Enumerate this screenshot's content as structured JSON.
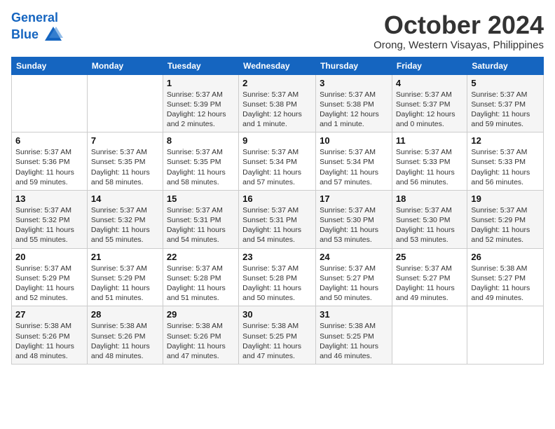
{
  "header": {
    "logo_line1": "General",
    "logo_line2": "Blue",
    "month_title": "October 2024",
    "location": "Orong, Western Visayas, Philippines"
  },
  "weekdays": [
    "Sunday",
    "Monday",
    "Tuesday",
    "Wednesday",
    "Thursday",
    "Friday",
    "Saturday"
  ],
  "weeks": [
    [
      {
        "day": "",
        "info": ""
      },
      {
        "day": "",
        "info": ""
      },
      {
        "day": "1",
        "info": "Sunrise: 5:37 AM\nSunset: 5:39 PM\nDaylight: 12 hours\nand 2 minutes."
      },
      {
        "day": "2",
        "info": "Sunrise: 5:37 AM\nSunset: 5:38 PM\nDaylight: 12 hours\nand 1 minute."
      },
      {
        "day": "3",
        "info": "Sunrise: 5:37 AM\nSunset: 5:38 PM\nDaylight: 12 hours\nand 1 minute."
      },
      {
        "day": "4",
        "info": "Sunrise: 5:37 AM\nSunset: 5:37 PM\nDaylight: 12 hours\nand 0 minutes."
      },
      {
        "day": "5",
        "info": "Sunrise: 5:37 AM\nSunset: 5:37 PM\nDaylight: 11 hours\nand 59 minutes."
      }
    ],
    [
      {
        "day": "6",
        "info": "Sunrise: 5:37 AM\nSunset: 5:36 PM\nDaylight: 11 hours\nand 59 minutes."
      },
      {
        "day": "7",
        "info": "Sunrise: 5:37 AM\nSunset: 5:35 PM\nDaylight: 11 hours\nand 58 minutes."
      },
      {
        "day": "8",
        "info": "Sunrise: 5:37 AM\nSunset: 5:35 PM\nDaylight: 11 hours\nand 58 minutes."
      },
      {
        "day": "9",
        "info": "Sunrise: 5:37 AM\nSunset: 5:34 PM\nDaylight: 11 hours\nand 57 minutes."
      },
      {
        "day": "10",
        "info": "Sunrise: 5:37 AM\nSunset: 5:34 PM\nDaylight: 11 hours\nand 57 minutes."
      },
      {
        "day": "11",
        "info": "Sunrise: 5:37 AM\nSunset: 5:33 PM\nDaylight: 11 hours\nand 56 minutes."
      },
      {
        "day": "12",
        "info": "Sunrise: 5:37 AM\nSunset: 5:33 PM\nDaylight: 11 hours\nand 56 minutes."
      }
    ],
    [
      {
        "day": "13",
        "info": "Sunrise: 5:37 AM\nSunset: 5:32 PM\nDaylight: 11 hours\nand 55 minutes."
      },
      {
        "day": "14",
        "info": "Sunrise: 5:37 AM\nSunset: 5:32 PM\nDaylight: 11 hours\nand 55 minutes."
      },
      {
        "day": "15",
        "info": "Sunrise: 5:37 AM\nSunset: 5:31 PM\nDaylight: 11 hours\nand 54 minutes."
      },
      {
        "day": "16",
        "info": "Sunrise: 5:37 AM\nSunset: 5:31 PM\nDaylight: 11 hours\nand 54 minutes."
      },
      {
        "day": "17",
        "info": "Sunrise: 5:37 AM\nSunset: 5:30 PM\nDaylight: 11 hours\nand 53 minutes."
      },
      {
        "day": "18",
        "info": "Sunrise: 5:37 AM\nSunset: 5:30 PM\nDaylight: 11 hours\nand 53 minutes."
      },
      {
        "day": "19",
        "info": "Sunrise: 5:37 AM\nSunset: 5:29 PM\nDaylight: 11 hours\nand 52 minutes."
      }
    ],
    [
      {
        "day": "20",
        "info": "Sunrise: 5:37 AM\nSunset: 5:29 PM\nDaylight: 11 hours\nand 52 minutes."
      },
      {
        "day": "21",
        "info": "Sunrise: 5:37 AM\nSunset: 5:29 PM\nDaylight: 11 hours\nand 51 minutes."
      },
      {
        "day": "22",
        "info": "Sunrise: 5:37 AM\nSunset: 5:28 PM\nDaylight: 11 hours\nand 51 minutes."
      },
      {
        "day": "23",
        "info": "Sunrise: 5:37 AM\nSunset: 5:28 PM\nDaylight: 11 hours\nand 50 minutes."
      },
      {
        "day": "24",
        "info": "Sunrise: 5:37 AM\nSunset: 5:27 PM\nDaylight: 11 hours\nand 50 minutes."
      },
      {
        "day": "25",
        "info": "Sunrise: 5:37 AM\nSunset: 5:27 PM\nDaylight: 11 hours\nand 49 minutes."
      },
      {
        "day": "26",
        "info": "Sunrise: 5:38 AM\nSunset: 5:27 PM\nDaylight: 11 hours\nand 49 minutes."
      }
    ],
    [
      {
        "day": "27",
        "info": "Sunrise: 5:38 AM\nSunset: 5:26 PM\nDaylight: 11 hours\nand 48 minutes."
      },
      {
        "day": "28",
        "info": "Sunrise: 5:38 AM\nSunset: 5:26 PM\nDaylight: 11 hours\nand 48 minutes."
      },
      {
        "day": "29",
        "info": "Sunrise: 5:38 AM\nSunset: 5:26 PM\nDaylight: 11 hours\nand 47 minutes."
      },
      {
        "day": "30",
        "info": "Sunrise: 5:38 AM\nSunset: 5:25 PM\nDaylight: 11 hours\nand 47 minutes."
      },
      {
        "day": "31",
        "info": "Sunrise: 5:38 AM\nSunset: 5:25 PM\nDaylight: 11 hours\nand 46 minutes."
      },
      {
        "day": "",
        "info": ""
      },
      {
        "day": "",
        "info": ""
      }
    ]
  ]
}
